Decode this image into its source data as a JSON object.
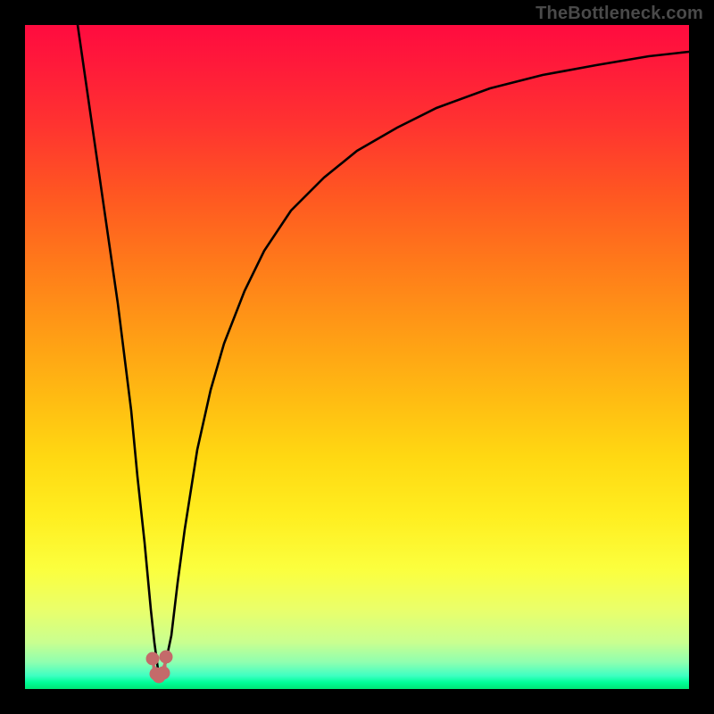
{
  "watermark": "TheBottleneck.com",
  "chart_data": {
    "type": "line",
    "title": "",
    "xlabel": "",
    "ylabel": "",
    "xlim": [
      0,
      100
    ],
    "ylim": [
      0,
      100
    ],
    "grid": false,
    "legend": null,
    "series": [
      {
        "name": "bottleneck-curve",
        "x": [
          8,
          10,
          12,
          14,
          16,
          17,
          18,
          19,
          19.5,
          20,
          20.5,
          21,
          22,
          23,
          24,
          26,
          28,
          30,
          33,
          36,
          40,
          45,
          50,
          56,
          62,
          70,
          78,
          86,
          94,
          100
        ],
        "y": [
          100,
          86,
          72,
          58,
          42,
          32,
          22,
          12,
          7,
          3,
          2,
          3,
          8,
          16,
          24,
          36,
          45,
          52,
          60,
          66,
          72,
          77,
          81,
          84.5,
          87.5,
          90.5,
          92.5,
          94,
          95.3,
          96
        ]
      },
      {
        "name": "marker-cluster",
        "x": [
          19.2,
          19.7,
          20.2,
          20.8,
          21.3
        ],
        "y": [
          4.5,
          2.2,
          1.8,
          2.4,
          4.8
        ]
      }
    ],
    "colors": {
      "curve": "#000000",
      "marker": "#c46a6a",
      "gradient_top": "#ff0b3f",
      "gradient_bottom": "#00e676"
    }
  }
}
